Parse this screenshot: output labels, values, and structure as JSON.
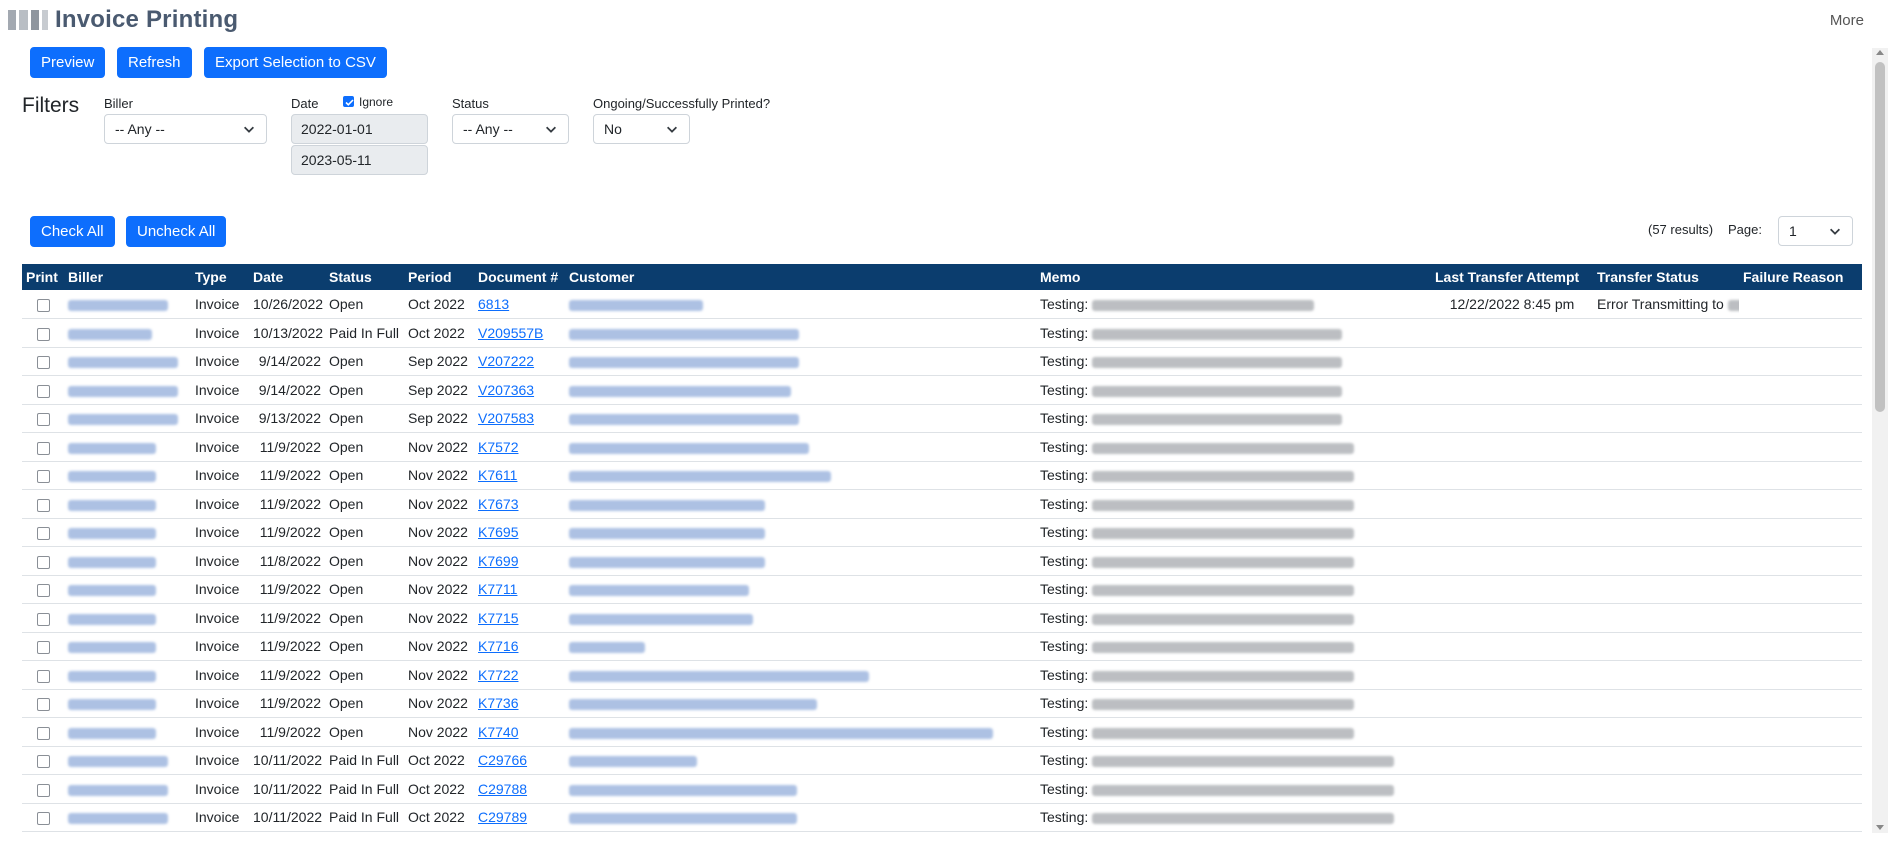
{
  "header": {
    "title": "Invoice Printing",
    "more": "More"
  },
  "toolbar": {
    "preview": "Preview",
    "refresh": "Refresh",
    "export": "Export Selection to CSV"
  },
  "filters": {
    "title": "Filters",
    "biller_label": "Biller",
    "biller_value": "-- Any --",
    "date_label": "Date",
    "ignore_label": "Ignore",
    "date_from": "2022-01-01",
    "date_to": "2023-05-11",
    "status_label": "Status",
    "status_value": "-- Any --",
    "printed_label": "Ongoing/Successfully Printed?",
    "printed_value": "No"
  },
  "actions": {
    "check_all": "Check All",
    "uncheck_all": "Uncheck All"
  },
  "pagination": {
    "results": "(57 results)",
    "page_label": "Page:",
    "page_value": "1"
  },
  "table": {
    "columns": [
      "Print",
      "Biller",
      "Type",
      "Date",
      "Status",
      "Period",
      "Document #",
      "Customer",
      "Memo",
      "Last Transfer Attempt",
      "Transfer Status",
      "Failure Reason"
    ],
    "rows": [
      {
        "type": "Invoice",
        "date": "10/26/2022",
        "status": "Open",
        "period": "Oct 2022",
        "doc": "6813",
        "memo": "Testing:",
        "last_attempt": "12/22/2022 8:45 pm",
        "transfer_status": "Error Transmitting to",
        "failure": ""
      },
      {
        "type": "Invoice",
        "date": "10/13/2022",
        "status": "Paid In Full",
        "period": "Oct 2022",
        "doc": "V209557B",
        "memo": "Testing:",
        "last_attempt": "",
        "transfer_status": "",
        "failure": ""
      },
      {
        "type": "Invoice",
        "date": "9/14/2022",
        "status": "Open",
        "period": "Sep 2022",
        "doc": "V207222",
        "memo": "Testing:",
        "last_attempt": "",
        "transfer_status": "",
        "failure": ""
      },
      {
        "type": "Invoice",
        "date": "9/14/2022",
        "status": "Open",
        "period": "Sep 2022",
        "doc": "V207363",
        "memo": "Testing:",
        "last_attempt": "",
        "transfer_status": "",
        "failure": ""
      },
      {
        "type": "Invoice",
        "date": "9/13/2022",
        "status": "Open",
        "period": "Sep 2022",
        "doc": "V207583",
        "memo": "Testing:",
        "last_attempt": "",
        "transfer_status": "",
        "failure": ""
      },
      {
        "type": "Invoice",
        "date": "11/9/2022",
        "status": "Open",
        "period": "Nov 2022",
        "doc": "K7572",
        "memo": "Testing:",
        "last_attempt": "",
        "transfer_status": "",
        "failure": ""
      },
      {
        "type": "Invoice",
        "date": "11/9/2022",
        "status": "Open",
        "period": "Nov 2022",
        "doc": "K7611",
        "memo": "Testing:",
        "last_attempt": "",
        "transfer_status": "",
        "failure": ""
      },
      {
        "type": "Invoice",
        "date": "11/9/2022",
        "status": "Open",
        "period": "Nov 2022",
        "doc": "K7673",
        "memo": "Testing:",
        "last_attempt": "",
        "transfer_status": "",
        "failure": ""
      },
      {
        "type": "Invoice",
        "date": "11/9/2022",
        "status": "Open",
        "period": "Nov 2022",
        "doc": "K7695",
        "memo": "Testing:",
        "last_attempt": "",
        "transfer_status": "",
        "failure": ""
      },
      {
        "type": "Invoice",
        "date": "11/8/2022",
        "status": "Open",
        "period": "Nov 2022",
        "doc": "K7699",
        "memo": "Testing:",
        "last_attempt": "",
        "transfer_status": "",
        "failure": ""
      },
      {
        "type": "Invoice",
        "date": "11/9/2022",
        "status": "Open",
        "period": "Nov 2022",
        "doc": "K7711",
        "memo": "Testing:",
        "last_attempt": "",
        "transfer_status": "",
        "failure": ""
      },
      {
        "type": "Invoice",
        "date": "11/9/2022",
        "status": "Open",
        "period": "Nov 2022",
        "doc": "K7715",
        "memo": "Testing:",
        "last_attempt": "",
        "transfer_status": "",
        "failure": ""
      },
      {
        "type": "Invoice",
        "date": "11/9/2022",
        "status": "Open",
        "period": "Nov 2022",
        "doc": "K7716",
        "memo": "Testing:",
        "last_attempt": "",
        "transfer_status": "",
        "failure": ""
      },
      {
        "type": "Invoice",
        "date": "11/9/2022",
        "status": "Open",
        "period": "Nov 2022",
        "doc": "K7722",
        "memo": "Testing:",
        "last_attempt": "",
        "transfer_status": "",
        "failure": ""
      },
      {
        "type": "Invoice",
        "date": "11/9/2022",
        "status": "Open",
        "period": "Nov 2022",
        "doc": "K7736",
        "memo": "Testing:",
        "last_attempt": "",
        "transfer_status": "",
        "failure": ""
      },
      {
        "type": "Invoice",
        "date": "11/9/2022",
        "status": "Open",
        "period": "Nov 2022",
        "doc": "K7740",
        "memo": "Testing:",
        "last_attempt": "",
        "transfer_status": "",
        "failure": ""
      },
      {
        "type": "Invoice",
        "date": "10/11/2022",
        "status": "Paid In Full",
        "period": "Oct 2022",
        "doc": "C29766",
        "memo": "Testing:",
        "last_attempt": "",
        "transfer_status": "",
        "failure": ""
      },
      {
        "type": "Invoice",
        "date": "10/11/2022",
        "status": "Paid In Full",
        "period": "Oct 2022",
        "doc": "C29788",
        "memo": "Testing:",
        "last_attempt": "",
        "transfer_status": "",
        "failure": ""
      },
      {
        "type": "Invoice",
        "date": "10/11/2022",
        "status": "Paid In Full",
        "period": "Oct 2022",
        "doc": "C29789",
        "memo": "Testing:",
        "last_attempt": "",
        "transfer_status": "",
        "failure": ""
      }
    ]
  },
  "colors": {
    "primary": "#0d6efd",
    "table_header": "#0b3d6e",
    "title": "#4a5a70"
  }
}
